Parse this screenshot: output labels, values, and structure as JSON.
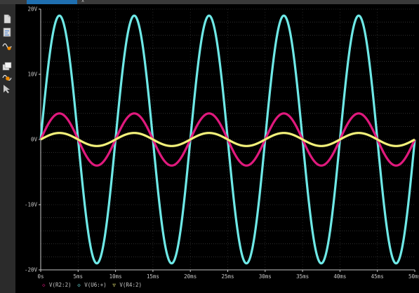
{
  "window": {
    "tab_close": "x"
  },
  "toolbar": {
    "tools": [
      "new-page-icon",
      "schematic-icon",
      "add-trace-icon",
      "stack-windows-icon",
      "probe-icon",
      "cursor-icon"
    ]
  },
  "colors": {
    "background": "#000000",
    "grid": "#8a8a8a",
    "axis": "#c8c8c8",
    "series": [
      "#e0197d",
      "#6ee8e6",
      "#f2f07a"
    ]
  },
  "chart_data": {
    "type": "line",
    "title": "",
    "xlabel": "",
    "ylabel": "",
    "x_unit": "ms",
    "y_unit": "V",
    "xlim": [
      0,
      50
    ],
    "ylim": [
      -20,
      20
    ],
    "grid": true,
    "x_ticks": [
      "0s",
      "5ms",
      "10ms",
      "15ms",
      "20ms",
      "25ms",
      "30ms",
      "35ms",
      "40ms",
      "45ms",
      "50ms"
    ],
    "y_ticks": [
      "20V",
      "10V",
      "0V",
      "-10V",
      "-20V"
    ],
    "legend_position": "bottom-left",
    "series": [
      {
        "name": "V(R2:2)",
        "marker": "◇",
        "waveform": "sine",
        "amplitude": 4,
        "frequency_hz": 100,
        "phase_deg": 0,
        "offset": 0
      },
      {
        "name": "V(U6:+)",
        "marker": "◇",
        "waveform": "sine",
        "amplitude": 19,
        "frequency_hz": 100,
        "phase_deg": 0,
        "offset": 0
      },
      {
        "name": "V(R4:2)",
        "marker": "▽",
        "waveform": "sine",
        "amplitude": 1,
        "frequency_hz": 100,
        "phase_deg": 0,
        "offset": 0
      }
    ]
  }
}
